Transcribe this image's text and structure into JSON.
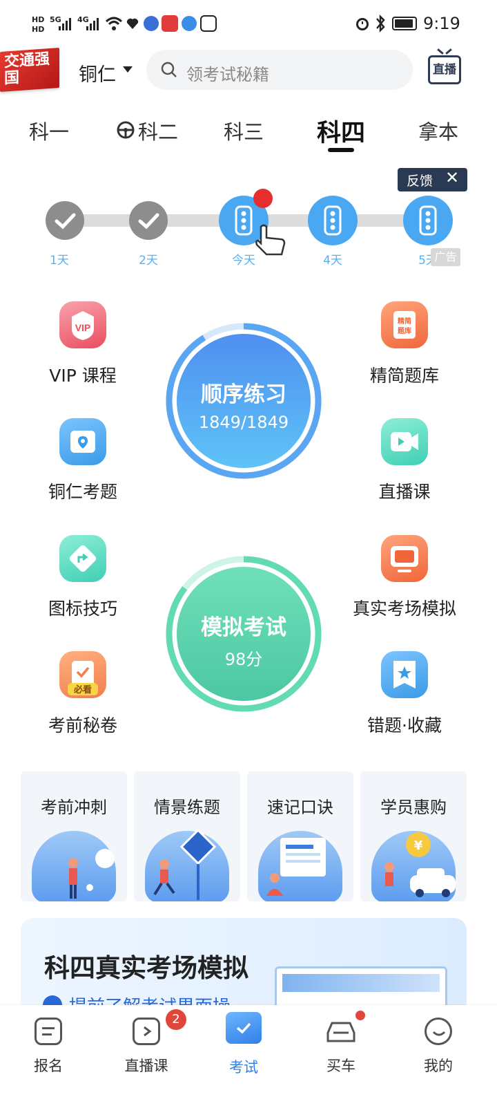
{
  "status_bar": {
    "time": "9:19",
    "network_1": "5G",
    "network_2": "4G",
    "hd_1": "HD",
    "hd_2": "HD"
  },
  "header": {
    "logo_text": "交通强国",
    "city": "铜仁",
    "search_placeholder": "领考试秘籍",
    "live_label": "直播"
  },
  "tabs": [
    {
      "label": "科一"
    },
    {
      "label": "科二"
    },
    {
      "label": "科三"
    },
    {
      "label": "科四"
    },
    {
      "label": "拿本"
    }
  ],
  "feedback": {
    "label": "反馈"
  },
  "ad_tag": "广告",
  "progress": {
    "nodes": [
      {
        "label": "1天",
        "state": "done"
      },
      {
        "label": "2天",
        "state": "done"
      },
      {
        "label": "今天",
        "state": "today"
      },
      {
        "label": "4天",
        "state": "todo"
      },
      {
        "label": "5天",
        "state": "todo"
      }
    ]
  },
  "features_left": [
    {
      "label": "VIP 课程",
      "icon": "vip-icon",
      "color": "#e94d5f"
    },
    {
      "label": "铜仁考题",
      "icon": "location-icon",
      "color": "#3a9be8"
    },
    {
      "label": "图标技巧",
      "icon": "arrow-sign-icon",
      "color": "#3fcfb3"
    },
    {
      "label": "考前秘卷",
      "icon": "exam-paper-icon",
      "color": "#f27f4a"
    }
  ],
  "features_right": [
    {
      "label": "精简题库",
      "icon": "question-bank-icon",
      "color": "#f0663a"
    },
    {
      "label": "直播课",
      "icon": "video-icon",
      "color": "#3fcfb3"
    },
    {
      "label": "真实考场模拟",
      "icon": "monitor-icon",
      "color": "#f0663a"
    },
    {
      "label": "错题·收藏",
      "icon": "star-bookmark-icon",
      "color": "#3a9be8"
    }
  ],
  "practice": {
    "title": "顺序练习",
    "progress_text": "1849/1849",
    "color": "#4c9bf0"
  },
  "mock_exam": {
    "title": "模拟考试",
    "score_text": "98分",
    "color": "#4fd1a8"
  },
  "cards": [
    {
      "title": "考前冲刺"
    },
    {
      "title": "情景练题"
    },
    {
      "title": "速记口诀"
    },
    {
      "title": "学员惠购"
    }
  ],
  "banner": {
    "title": "科四真实考场模拟",
    "subtitle": "提前了解考试界面操"
  },
  "bottom_nav": [
    {
      "label": "报名",
      "icon": "signup-icon"
    },
    {
      "label": "直播课",
      "icon": "live-class-icon",
      "badge": "2"
    },
    {
      "label": "考试",
      "icon": "exam-folder-icon",
      "active": true
    },
    {
      "label": "买车",
      "icon": "car-icon"
    },
    {
      "label": "我的",
      "icon": "profile-icon"
    }
  ]
}
